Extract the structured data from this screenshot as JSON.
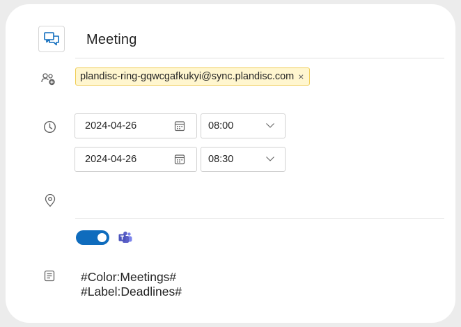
{
  "title": {
    "icon": "chat-bubbles-icon",
    "value": "Meeting"
  },
  "attendees": {
    "icon": "people-add-icon",
    "chips": [
      {
        "email": "plandisc-ring-gqwcgafkukyi@sync.plandisc.com",
        "remove_glyph": "×"
      }
    ]
  },
  "schedule": {
    "icon": "clock-icon",
    "start": {
      "date": "2024-04-26",
      "time": "08:00"
    },
    "end": {
      "date": "2024-04-26",
      "time": "08:30"
    }
  },
  "location": {
    "icon": "location-pin-icon",
    "value": ""
  },
  "online_meeting": {
    "toggle_on": true,
    "provider_icon": "teams-icon",
    "accent": "#0f6cbd"
  },
  "notes": {
    "icon": "notes-icon",
    "lines": [
      "#Color:Meetings#",
      "#Label:Deadlines#"
    ]
  },
  "colors": {
    "chip_bg": "#fff6cf",
    "chip_border": "#f0cd55",
    "teams": "#5b5fc7"
  }
}
